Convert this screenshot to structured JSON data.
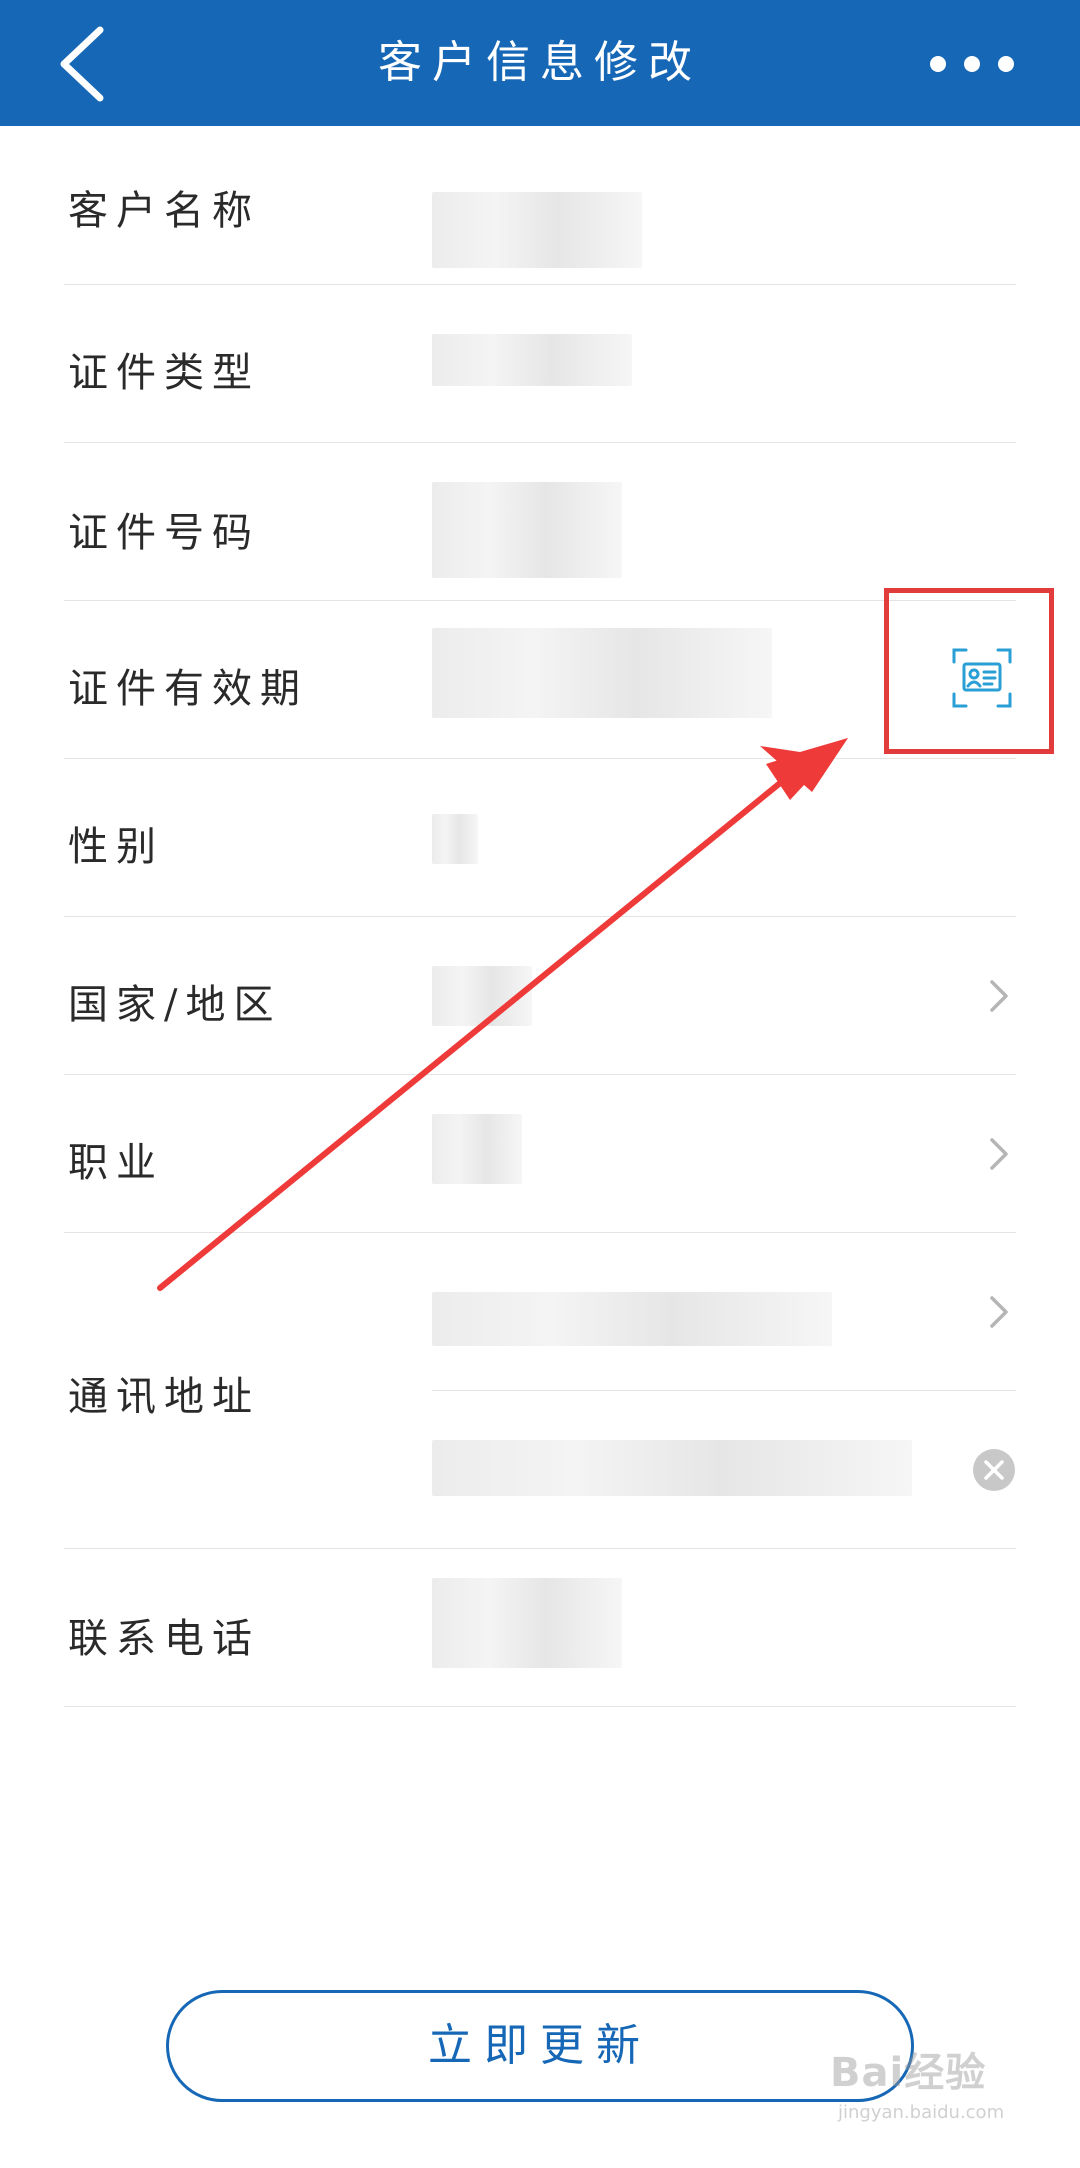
{
  "header": {
    "title": "客户信息修改",
    "back_icon": "chevron-left-icon",
    "more_icon": "more-horizontal-icon",
    "background_color": "#1668b6"
  },
  "form": {
    "rows": [
      {
        "label": "客户名称"
      },
      {
        "label": "证件类型"
      },
      {
        "label": "证件号码"
      },
      {
        "label": "证件有效期",
        "action_icon": "id-card-scan-icon"
      },
      {
        "label": "性别"
      },
      {
        "label": "国家/地区",
        "action_icon": "chevron-right-icon"
      },
      {
        "label": "职业",
        "action_icon": "chevron-right-icon"
      },
      {
        "label": "通讯地址",
        "action_icons": [
          "chevron-right-icon",
          "clear-icon"
        ]
      },
      {
        "label": "联系电话"
      }
    ],
    "highlight_color": "#e23b3b",
    "scan_icon_color": "#2a9fd6"
  },
  "submit": {
    "label": "立即更新"
  },
  "watermark": {
    "logo": "Bai经验",
    "url": "jingyan.baidu.com"
  }
}
